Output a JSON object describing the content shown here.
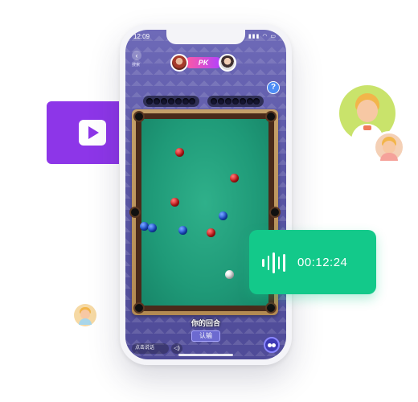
{
  "status_bar": {
    "time": "12:09",
    "icons": "▮▮▮ ◠ ▭"
  },
  "header": {
    "back_icon": "‹",
    "sub_label": "搜索",
    "pk_label": "PK",
    "help_label": "?"
  },
  "game": {
    "turn_text": "你的回合",
    "concede_label": "认输",
    "voice_input_label": "点击说话",
    "speaker_icon": "◁)"
  },
  "voice_card": {
    "duration": "00:12:24"
  },
  "colors": {
    "video_accent": "#8d36e8",
    "voice_accent": "#13c98a",
    "felt": "#1f9a78"
  }
}
